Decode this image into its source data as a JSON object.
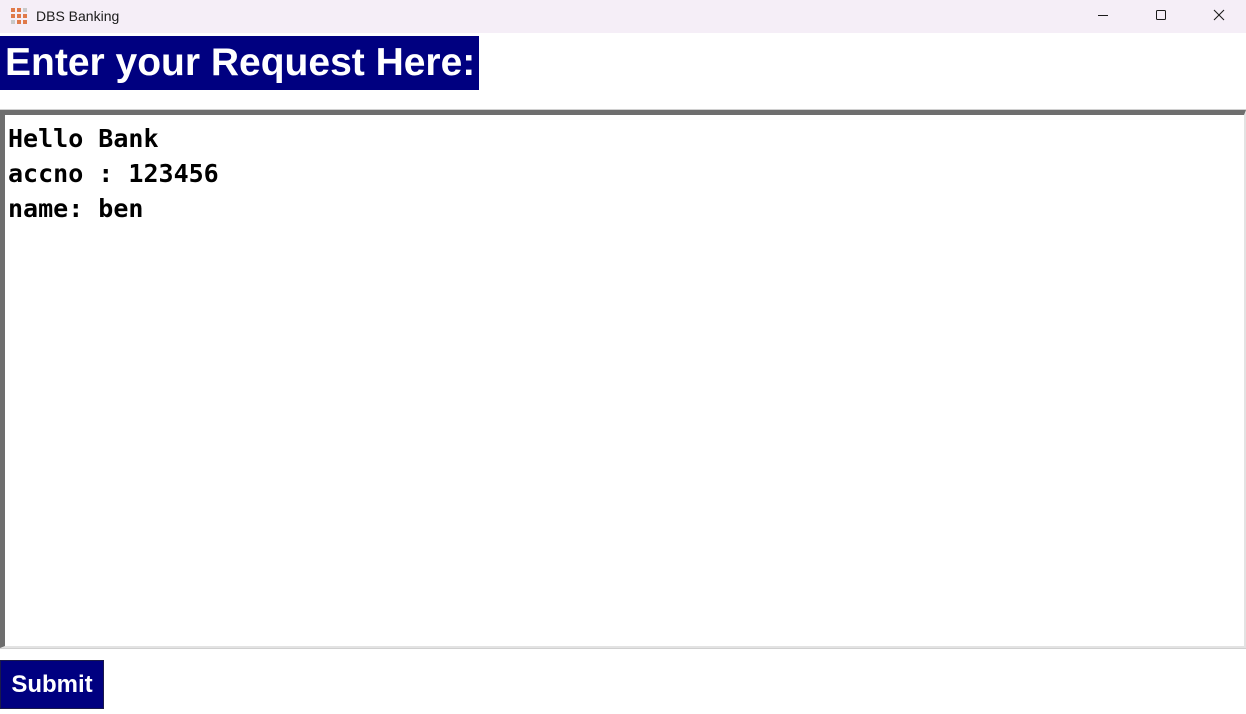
{
  "window": {
    "title": "DBS Banking",
    "controls": {
      "minimize_icon": "minimize-icon",
      "maximize_icon": "maximize-icon",
      "close_icon": "close-icon"
    }
  },
  "form": {
    "heading": "Enter your Request Here:",
    "request_text": "Hello Bank\naccno : 123456\nname: ben",
    "submit_label": "Submit"
  },
  "colors": {
    "accent": "#000080",
    "titlebar": "#f5eef7"
  }
}
